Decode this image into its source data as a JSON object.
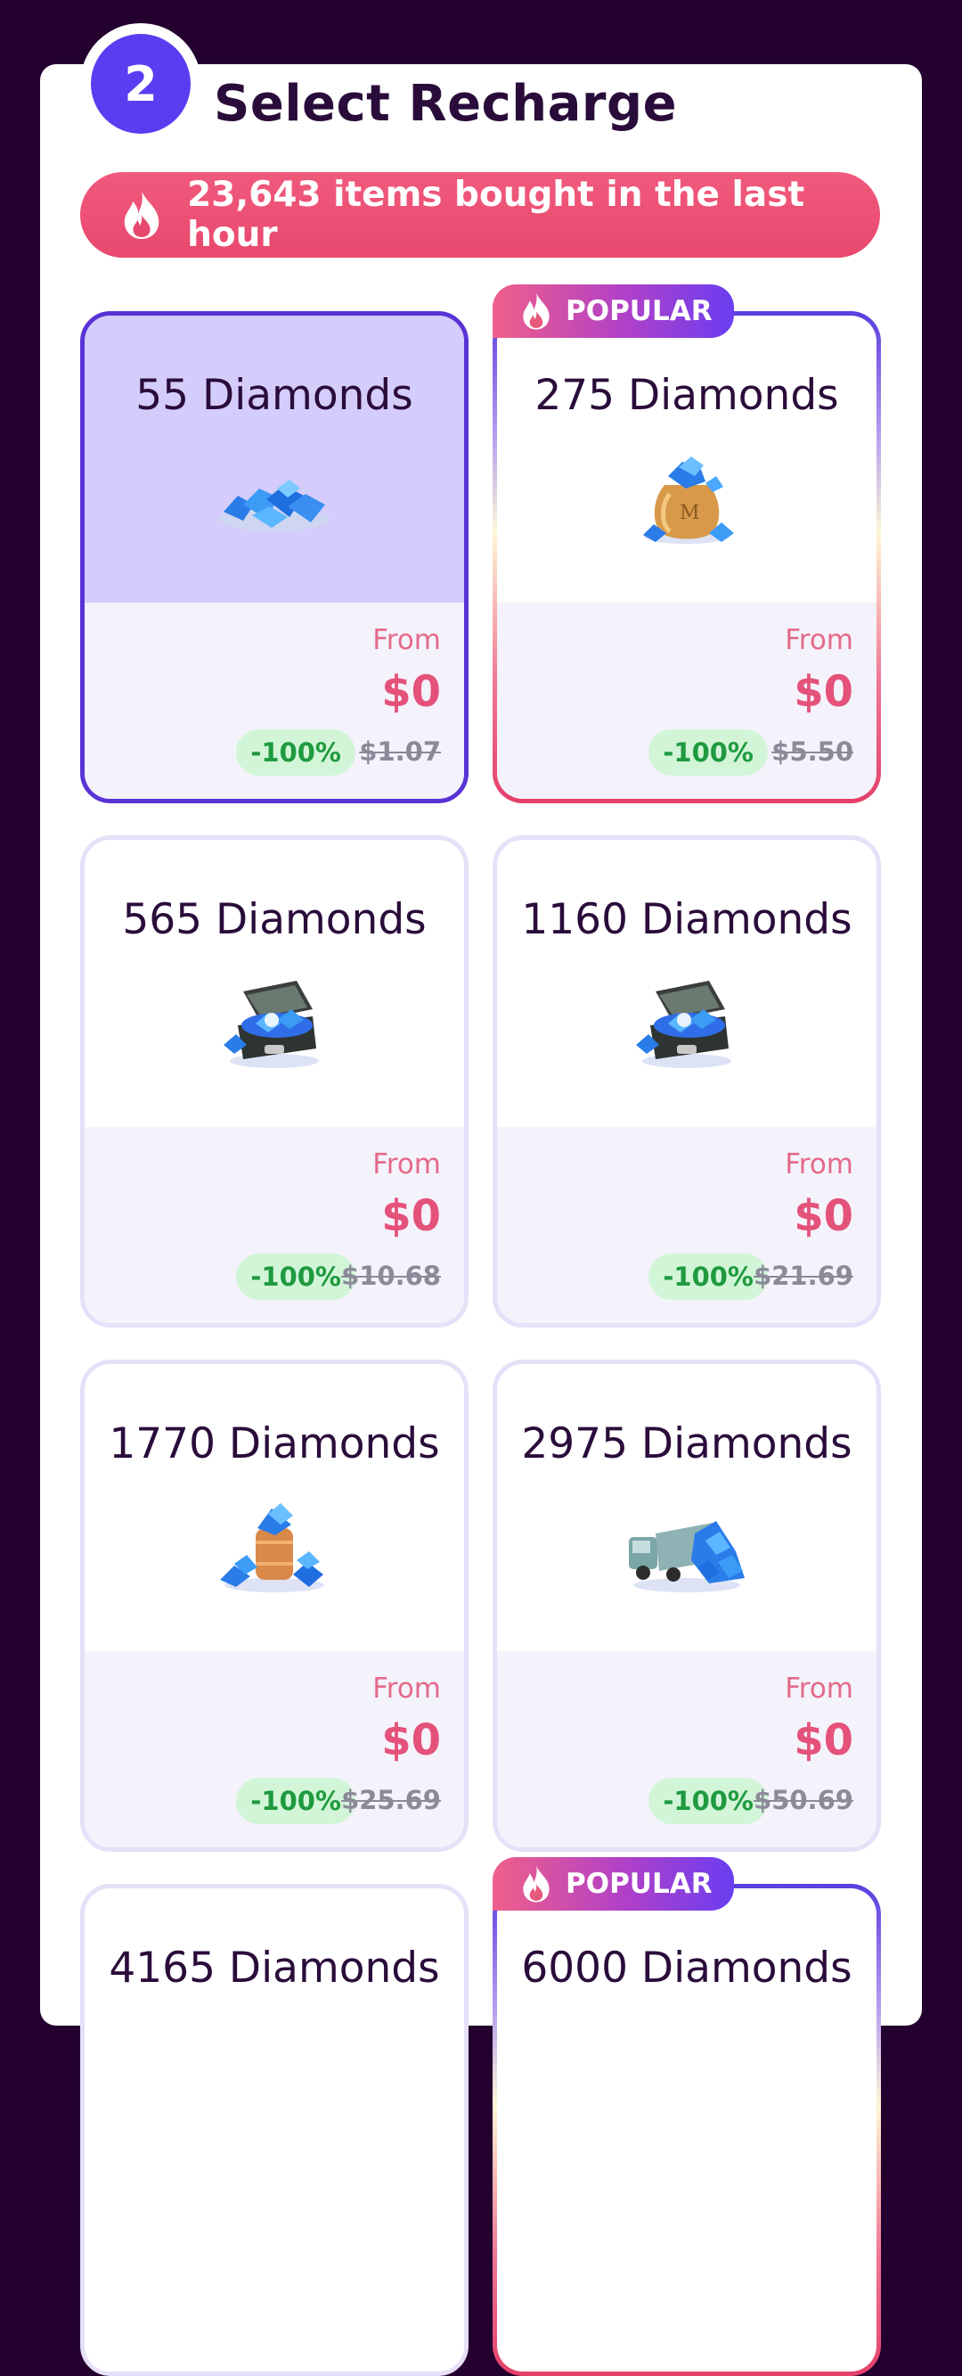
{
  "step": {
    "number": "2",
    "title": "Select Recharge"
  },
  "banner": {
    "icon": "flame-icon",
    "text": "23,643 items bought in the last hour"
  },
  "badge_label": "POPULAR",
  "cards": [
    {
      "name": "55 Diamonds",
      "from": "From",
      "price": "$0",
      "discount": "-100%",
      "original": "$1.07",
      "selected": true,
      "popular": false,
      "image": "diamond-pile-icon"
    },
    {
      "name": "275 Diamonds",
      "from": "From",
      "price": "$0",
      "discount": "-100%",
      "original": "$5.50",
      "selected": false,
      "popular": true,
      "image": "diamond-bag-icon"
    },
    {
      "name": "565 Diamonds",
      "from": "From",
      "price": "$0",
      "discount": "-100%",
      "original": "$10.68",
      "selected": false,
      "popular": false,
      "image": "diamond-chest-icon"
    },
    {
      "name": "1160 Diamonds",
      "from": "From",
      "price": "$0",
      "discount": "-100%",
      "original": "$21.69",
      "selected": false,
      "popular": false,
      "image": "diamond-chest-icon"
    },
    {
      "name": "1770 Diamonds",
      "from": "From",
      "price": "$0",
      "discount": "-100%",
      "original": "$25.69",
      "selected": false,
      "popular": false,
      "image": "diamond-barrel-icon"
    },
    {
      "name": "2975 Diamonds",
      "from": "From",
      "price": "$0",
      "discount": "-100%",
      "original": "$50.69",
      "selected": false,
      "popular": false,
      "image": "diamond-truck-icon"
    },
    {
      "name": "4165 Diamonds",
      "selected": false,
      "popular": false
    },
    {
      "name": "6000 Diamonds",
      "selected": false,
      "popular": true
    }
  ],
  "colors": {
    "background": "#24002e",
    "accent": "#5a3df0",
    "price": "#e4527a",
    "discount": "#1f9a3f",
    "banner": "#e8486d"
  }
}
